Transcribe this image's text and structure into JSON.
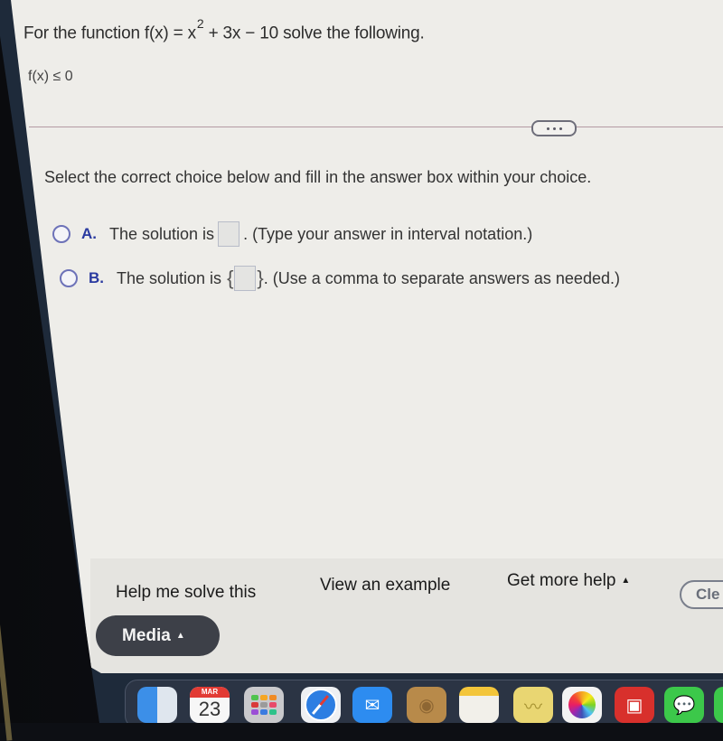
{
  "question": {
    "prompt_prefix": "For the function f(x) = x",
    "exponent": "2",
    "prompt_suffix": " + 3x − 10 solve the following.",
    "condition": "f(x) ≤ 0"
  },
  "more_button": {
    "icon": "ellipsis-icon"
  },
  "instruction": "Select the correct choice below and fill in the answer box within your choice.",
  "choices": [
    {
      "letter": "A.",
      "text_before": "The solution is",
      "answer_value": "",
      "text_after": ". (Type your answer in interval notation.)",
      "selected": false
    },
    {
      "letter": "B.",
      "text_before": "The solution is",
      "brace_open": "{",
      "answer_value": "",
      "brace_close": "}",
      "text_after": ". (Use a comma to separate answers as needed.)",
      "selected": false
    }
  ],
  "footer": {
    "help_me_solve": "Help me solve this",
    "view_example": "View an example",
    "get_more_help": "Get more help",
    "clear_all": "Cle",
    "media": "Media",
    "caret": "▲"
  },
  "dock": {
    "calendar_month": "MAR",
    "calendar_day": "23",
    "apps": [
      "Finder",
      "Calendar",
      "Launchpad",
      "Safari",
      "Mail",
      "Contacts",
      "Notes",
      "Stickies",
      "Photos",
      "Photo Booth",
      "Messages",
      "FaceTime"
    ]
  },
  "colors": {
    "choice_letter": "#2a3aa0",
    "radio_border": "#6d72b8",
    "media_button_bg": "#3d4048",
    "divider": "#b49aa3"
  }
}
